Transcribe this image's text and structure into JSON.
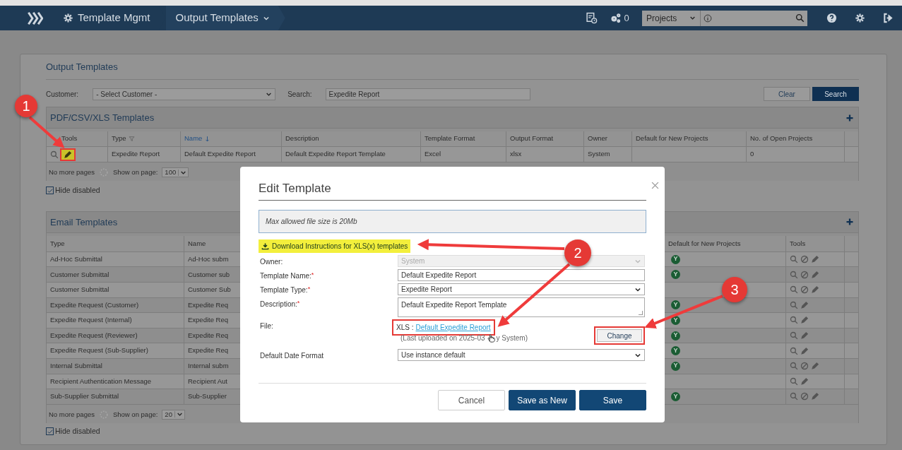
{
  "nav": {
    "breadcrumbs": [
      {
        "label": "Template Mgmt",
        "kind": "home"
      },
      {
        "label": "Output Templates",
        "kind": "menu"
      }
    ],
    "job_count": "0",
    "scope": "Projects"
  },
  "page": {
    "title": "Output Templates",
    "customer_label": "Customer:",
    "customer_value": "- Select Customer -",
    "search_label": "Search:",
    "search_value": "Expedite Report",
    "buttons": [
      {
        "label": "Clear",
        "kind": "secondary"
      },
      {
        "label": "Search",
        "kind": "primary"
      }
    ]
  },
  "pdf_templates": {
    "title": "PDF/CSV/XLS Templates",
    "tools_column": "Tools",
    "columns": [
      {
        "label": "Type",
        "sorted": false,
        "filter": true
      },
      {
        "label": "Name",
        "sorted": true,
        "filter": false
      },
      {
        "label": "Description",
        "sorted": false,
        "filter": false
      },
      {
        "label": "Template Format",
        "sorted": false,
        "filter": false
      },
      {
        "label": "Output Format",
        "sorted": false,
        "filter": false
      },
      {
        "label": "Owner",
        "sorted": false,
        "filter": false
      },
      {
        "label": "Default for New Projects",
        "sorted": false,
        "filter": false
      },
      {
        "label": "No. of Open Projects",
        "sorted": false,
        "filter": false
      }
    ],
    "rows": [
      {
        "tools": [
          {
            "kind": "view",
            "highlighted": false
          },
          {
            "kind": "edit",
            "highlighted": true
          }
        ],
        "cells": [
          "Expedite Report",
          "Default Expedite Report",
          "Default Expedite Report Template",
          "Excel",
          "xlsx",
          "System",
          null,
          "0"
        ]
      }
    ],
    "footer": {
      "status": "No more pages",
      "page_size_label": "Show on page:",
      "page_size": "100"
    },
    "hide_disabled": {
      "label": "Hide disabled",
      "checked": true
    }
  },
  "email_templates": {
    "title": "Email Templates",
    "columns": [
      {
        "label": "Type"
      },
      {
        "label": "Name"
      },
      {
        "label": "Default for New Projects"
      },
      {
        "label": "Tools"
      }
    ],
    "rows": [
      {
        "cells": [
          "Ad-Hoc Submittal",
          "Ad-Hoc subm"
        ],
        "default_badge": "Y",
        "tools": [
          {
            "kind": "view"
          },
          {
            "kind": "disable"
          },
          {
            "kind": "edit"
          }
        ]
      },
      {
        "cells": [
          "Customer Submittal",
          "Customer sub"
        ],
        "default_badge": "Y",
        "tools": [
          {
            "kind": "view"
          },
          {
            "kind": "disable"
          },
          {
            "kind": "edit"
          }
        ]
      },
      {
        "cells": [
          "Customer Submittal",
          "Customer Sub"
        ],
        "tools": [
          {
            "kind": "view"
          },
          {
            "kind": "disable"
          },
          {
            "kind": "edit"
          }
        ]
      },
      {
        "cells": [
          "Expedite Request (Customer)",
          "Expedite Req"
        ],
        "default_badge": "Y",
        "tools": [
          {
            "kind": "view"
          },
          {
            "kind": "edit"
          }
        ]
      },
      {
        "cells": [
          "Expedite Request (Internal)",
          "Expedite Req"
        ],
        "default_badge": "Y",
        "tools": [
          {
            "kind": "view"
          },
          {
            "kind": "edit"
          }
        ]
      },
      {
        "cells": [
          "Expedite Request (Reviewer)",
          "Expedite Req"
        ],
        "default_badge": "Y",
        "tools": [
          {
            "kind": "view"
          },
          {
            "kind": "edit"
          }
        ]
      },
      {
        "cells": [
          "Expedite Request (Sub-Supplier)",
          "Expedite Req"
        ],
        "default_badge": "Y",
        "tools": [
          {
            "kind": "view"
          },
          {
            "kind": "edit"
          }
        ]
      },
      {
        "cells": [
          "Internal Submittal",
          "Internal subm"
        ],
        "default_badge": "Y",
        "tools": [
          {
            "kind": "view"
          },
          {
            "kind": "disable"
          },
          {
            "kind": "edit"
          }
        ]
      },
      {
        "cells": [
          "Recipient Authentication Message",
          "Recipient Aut"
        ],
        "tools": [
          {
            "kind": "view"
          },
          {
            "kind": "edit"
          }
        ]
      },
      {
        "cells": [
          "Sub-Supplier Submittal",
          "Sub-Supplier"
        ],
        "default_badge": "Y",
        "tools": [
          {
            "kind": "view"
          },
          {
            "kind": "disable"
          },
          {
            "kind": "edit"
          }
        ]
      }
    ],
    "footer": {
      "status": "No more pages",
      "page_size_label": "Show on page:",
      "page_size": "20"
    },
    "hide_disabled": {
      "label": "Hide disabled",
      "checked": true
    }
  },
  "modal": {
    "title": "Edit Template",
    "info": "Max allowed file size is 20Mb",
    "download_link": {
      "label": "Download Instructions for XLS(x) templates",
      "highlighted": true
    },
    "fields": [
      {
        "label": "Owner:",
        "kind": "select",
        "value": "System",
        "disabled": true
      },
      {
        "label": "Template Name:",
        "required_mark": "*",
        "kind": "text",
        "value": "Default Expedite Report",
        "disabled": false
      },
      {
        "label": "Template Type:",
        "required_mark": "*",
        "kind": "select",
        "value": "Expedite Report",
        "disabled": false
      },
      {
        "label": "Description:",
        "required_mark": "*",
        "kind": "textarea",
        "value": "Default Expedite Report Template",
        "disabled": false
      },
      {
        "label": "File:",
        "kind": "file",
        "file_type": "XLS :",
        "file_name": "Default Expedite Report",
        "link_highlighted": true,
        "note_start": "(Last uploaded on 2025-03",
        "note_end": "y System)",
        "button": "Change",
        "button_highlighted": true
      },
      {
        "label": "Default Date Format",
        "kind": "select",
        "value": "Use instance default",
        "disabled": false
      }
    ],
    "buttons": [
      {
        "label": "Cancel",
        "kind": "secondary"
      },
      {
        "label": "Save as New",
        "kind": "primary"
      },
      {
        "label": "Save",
        "kind": "primary"
      }
    ]
  },
  "annotations": [
    {
      "number": "1"
    },
    {
      "number": "2"
    },
    {
      "number": "3"
    }
  ]
}
